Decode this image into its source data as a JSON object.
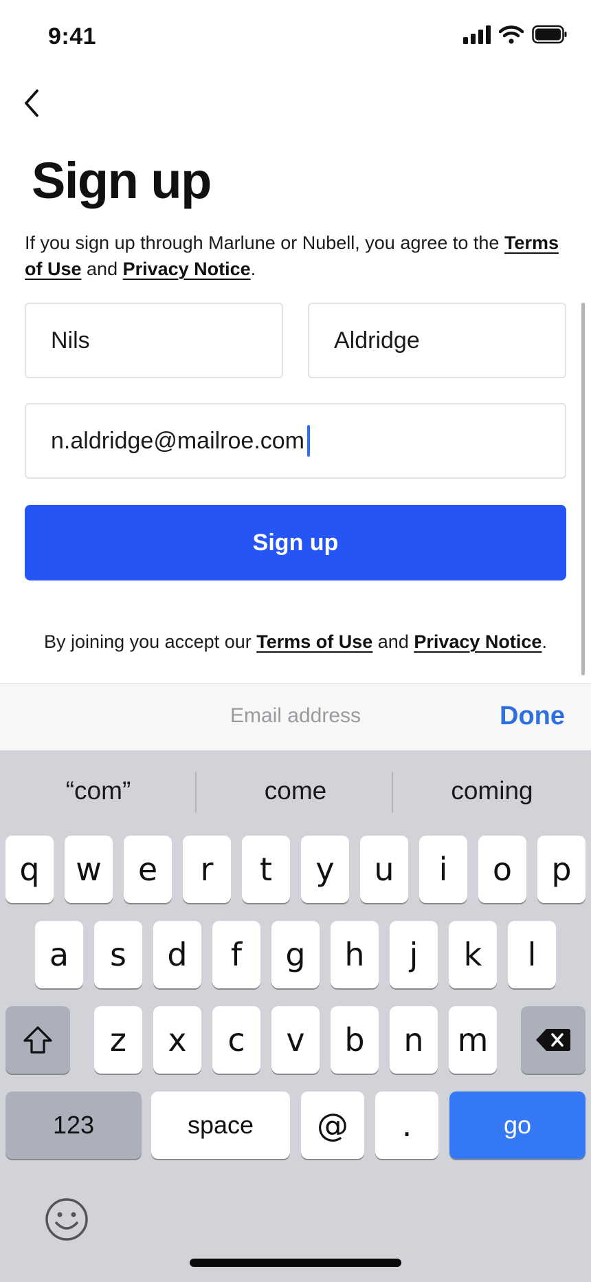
{
  "status_bar": {
    "time": "9:41"
  },
  "header": {
    "title": "Sign up"
  },
  "intro": {
    "text_before": "If you sign up through Marlune or Nubell, you agree to the ",
    "terms_link": "Terms of Use",
    "and": " and ",
    "privacy_link": "Privacy Notice",
    "period": "."
  },
  "form": {
    "first_name": "Nils",
    "last_name": "Aldridge",
    "email": "n.aldridge@mailroe.com",
    "submit_label": "Sign up"
  },
  "footer_note": {
    "text_before": "By joining you accept our ",
    "terms_link": "Terms of Use",
    "and": " and ",
    "privacy_link": "Privacy Notice",
    "period": "."
  },
  "accessory": {
    "field_label": "Email address",
    "done_label": "Done"
  },
  "keyboard": {
    "suggestions": [
      "“com”",
      "come",
      "coming"
    ],
    "row1": [
      "q",
      "w",
      "e",
      "r",
      "t",
      "y",
      "u",
      "i",
      "o",
      "p"
    ],
    "row2": [
      "a",
      "s",
      "d",
      "f",
      "g",
      "h",
      "j",
      "k",
      "l"
    ],
    "row3": [
      "z",
      "x",
      "c",
      "v",
      "b",
      "n",
      "m"
    ],
    "numbers_label": "123",
    "space_label": "space",
    "at_label": "@",
    "dot_label": ".",
    "go_label": "go"
  },
  "colors": {
    "primary": "#2556f5",
    "go_key": "#3478f6",
    "done": "#2f6fdf",
    "caret": "#2f6bff"
  },
  "icons": [
    "back-chevron-icon",
    "signal-icon",
    "wifi-icon",
    "battery-icon",
    "shift-icon",
    "delete-icon",
    "emoji-icon"
  ]
}
